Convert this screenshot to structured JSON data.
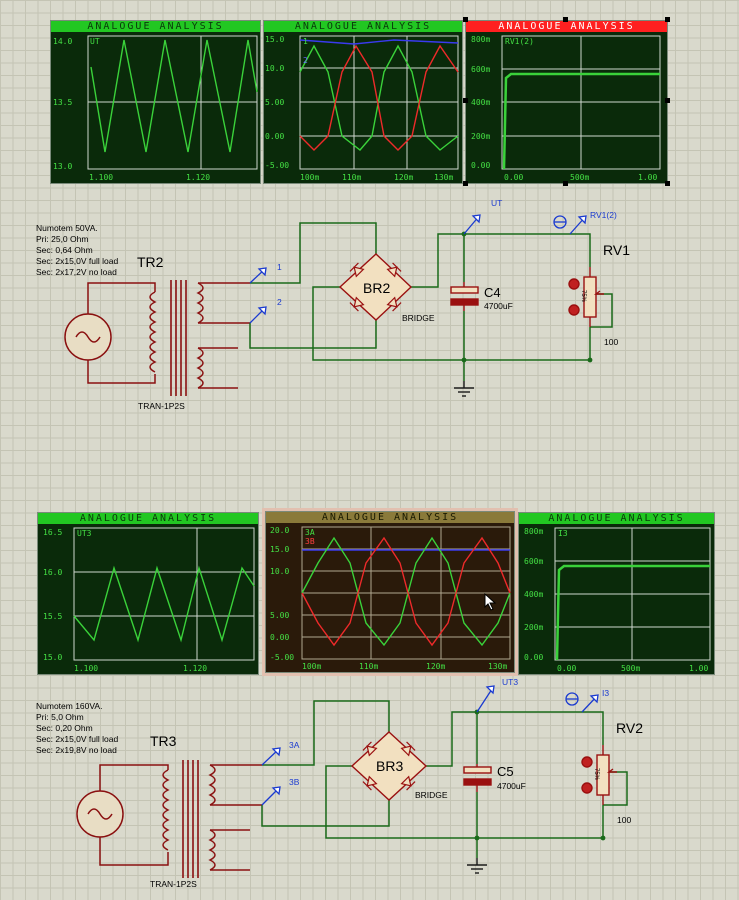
{
  "graphs": [
    {
      "id": "g1",
      "title": "ANALOGUE ANALYSIS",
      "trace": "UT",
      "y_ticks": [
        "14.0",
        "13.5",
        "13.0"
      ],
      "x_ticks": [
        "1.100",
        "1.120"
      ],
      "selected": false
    },
    {
      "id": "g2",
      "title": "ANALOGUE ANALYSIS",
      "traces": [
        "1",
        "2"
      ],
      "y_ticks": [
        "15.0",
        "10.0",
        "5.00",
        "0.00",
        "-5.00"
      ],
      "x_ticks": [
        "100m",
        "110m",
        "120m",
        "130m"
      ],
      "selected": false
    },
    {
      "id": "g3",
      "title": "ANALOGUE ANALYSIS",
      "trace": "RV1(2)",
      "y_ticks": [
        "800m",
        "600m",
        "400m",
        "200m",
        "0.00"
      ],
      "x_ticks": [
        "0.00",
        "500m",
        "1.00"
      ],
      "selected": true
    },
    {
      "id": "g4",
      "title": "ANALOGUE ANALYSIS",
      "trace": "UT3",
      "y_ticks": [
        "16.5",
        "16.0",
        "15.5",
        "15.0"
      ],
      "x_ticks": [
        "1.100",
        "1.120"
      ],
      "selected": false
    },
    {
      "id": "g5",
      "title": "ANALOGUE ANALYSIS",
      "traces": [
        "3A",
        "3B"
      ],
      "y_ticks": [
        "20.0",
        "15.0",
        "10.0",
        "5.00",
        "0.00",
        "-5.00"
      ],
      "x_ticks": [
        "100m",
        "110m",
        "120m",
        "130m"
      ],
      "selected": false
    },
    {
      "id": "g6",
      "title": "ANALOGUE ANALYSIS",
      "trace": "I3",
      "y_ticks": [
        "800m",
        "600m",
        "400m",
        "200m",
        "0.00"
      ],
      "x_ticks": [
        "0.00",
        "500m",
        "1.00"
      ],
      "selected": false
    }
  ],
  "circuit1": {
    "notes": [
      "Numotem 50VA.",
      "Pri: 25,0 Ohm",
      "Sec: 0,64 Ohm",
      "Sec: 2x15,0V full load",
      "Sec: 2x17,2V no load"
    ],
    "transformer_ref": "TR2",
    "transformer_type": "TRAN-1P2S",
    "bridge_ref": "BR2",
    "bridge_type": "BRIDGE",
    "cap_ref": "C4",
    "cap_value": "4700uF",
    "pot_ref": "RV1",
    "pot_value": "100",
    "probe_a": "1",
    "probe_b": "2",
    "probe_out": "UT",
    "current_probe": "RV1(2)"
  },
  "circuit2": {
    "notes": [
      "Numotem 160VA.",
      "Pri: 5,0 Ohm",
      "Sec: 0,20 Ohm",
      "Sec: 2x15,0V full load",
      "Sec: 2x19,8V no load"
    ],
    "transformer_ref": "TR3",
    "transformer_type": "TRAN-1P2S",
    "bridge_ref": "BR3",
    "bridge_type": "BRIDGE",
    "cap_ref": "C5",
    "cap_value": "4700uF",
    "pot_ref": "RV2",
    "pot_value": "100",
    "probe_a": "3A",
    "probe_b": "3B",
    "probe_out": "UT3",
    "current_probe": "I3"
  },
  "pot_scale": "75%"
}
